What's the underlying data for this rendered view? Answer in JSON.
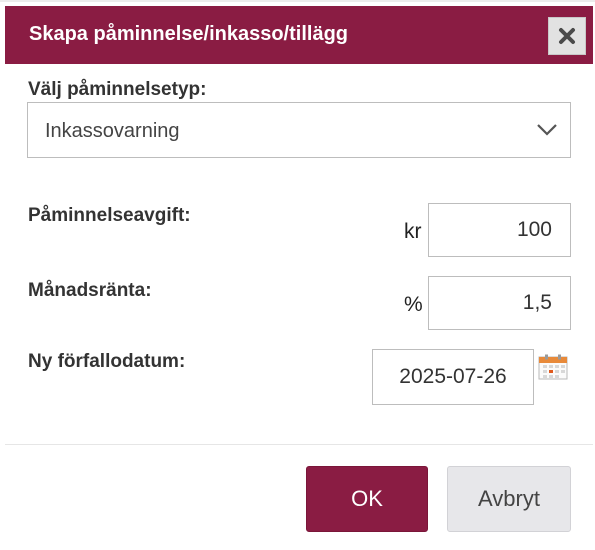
{
  "dialog": {
    "title": "Skapa påminnelse/inkasso/tillägg",
    "close_icon": "close-x-icon",
    "accent_color": "#8a1c43"
  },
  "reminder_type": {
    "label": "Välj påminnelsetyp:",
    "selected": "Inkassovarning",
    "dropdown_icon": "chevron-down-icon"
  },
  "fee": {
    "label": "Påminnelseavgift:",
    "unit": "kr",
    "value": "100"
  },
  "interest": {
    "label": "Månadsränta:",
    "unit": "%",
    "value": "1,5"
  },
  "due_date": {
    "label": "Ny förfallodatum:",
    "value": "2025-07-26",
    "picker_icon": "calendar-icon"
  },
  "actions": {
    "ok_label": "OK",
    "cancel_label": "Avbryt"
  }
}
